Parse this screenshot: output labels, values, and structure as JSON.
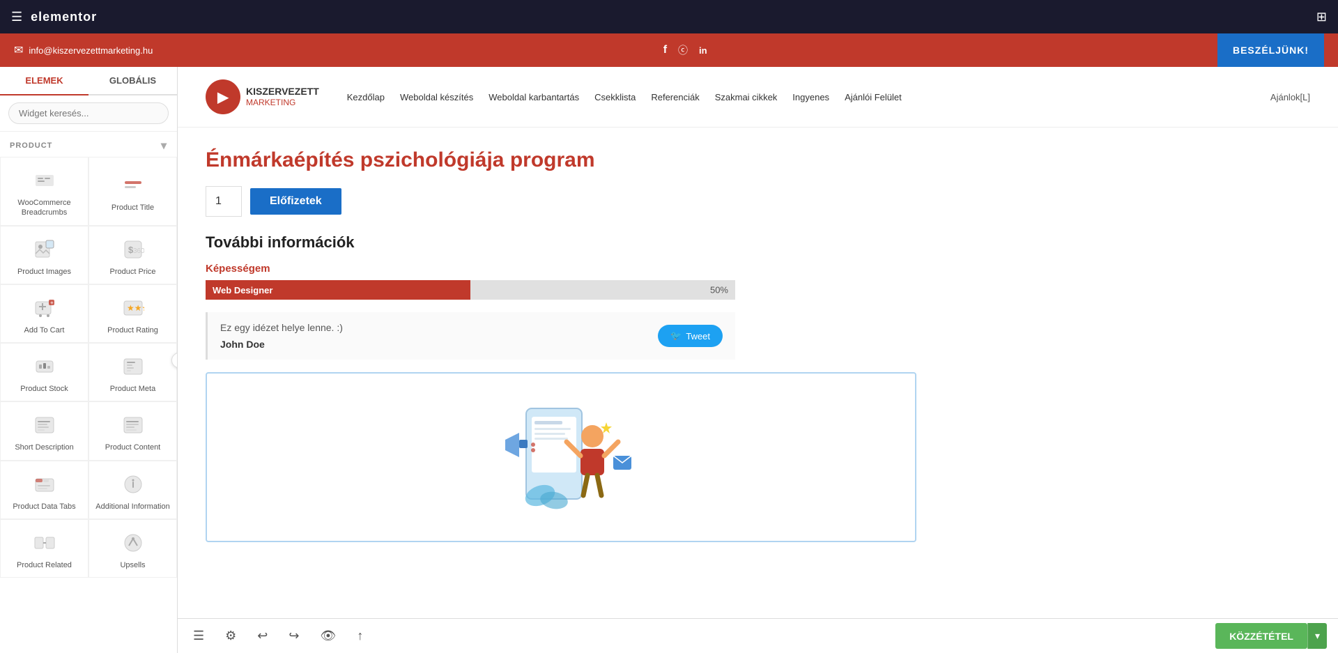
{
  "topbar": {
    "email": "info@kiszervezettmarketing.hu",
    "speak_btn": "BESZÉLJÜNK!",
    "email_icon": "✉",
    "facebook_icon": "f",
    "instagram_icon": "📷",
    "linkedin_icon": "in"
  },
  "elementor_header": {
    "logo": "elementor",
    "hamburger_icon": "☰",
    "grid_icon": "⊞"
  },
  "sidebar": {
    "tab_elemek": "ELEMEK",
    "tab_globalis": "GLOBÁLIS",
    "search_placeholder": "Widget keresés...",
    "section_label": "PRODUCT",
    "widgets": [
      {
        "id": "woocommerce-breadcrumbs",
        "label": "WooCommerce Breadcrumbs"
      },
      {
        "id": "product-title",
        "label": "Product Title"
      },
      {
        "id": "product-images",
        "label": "Product Images"
      },
      {
        "id": "product-price",
        "label": "Product Price"
      },
      {
        "id": "add-to-cart",
        "label": "Add To Cart"
      },
      {
        "id": "product-rating",
        "label": "Product Rating"
      },
      {
        "id": "product-stock",
        "label": "Product Stock"
      },
      {
        "id": "product-meta",
        "label": "Product Meta"
      },
      {
        "id": "short-description",
        "label": "Short Description"
      },
      {
        "id": "product-content",
        "label": "Product Content"
      },
      {
        "id": "product-data-tabs",
        "label": "Product Data Tabs"
      },
      {
        "id": "additional-information",
        "label": "Additional Information"
      },
      {
        "id": "product-related",
        "label": "Product Related"
      },
      {
        "id": "upsells",
        "label": "Upsells"
      }
    ]
  },
  "site_nav": {
    "logo_text_main": "KISZERVEZETT",
    "logo_text_sub": "MARKETING",
    "links": [
      "Kezdőlap",
      "Weboldal készítés",
      "Weboldal karbantartás",
      "Csekklista",
      "Referenciák",
      "Szakmai cikkek",
      "Ingyenes",
      "Ajánlói Felület"
    ],
    "ajanloi": "Ajánlok[L]"
  },
  "product": {
    "title": "Énmárkaépítés pszichológiája program",
    "qty_value": "1",
    "subscribe_btn": "Előfizetek",
    "further_info": "További információk",
    "kepessegem_label": "Képességem",
    "skill_name": "Web Designer",
    "skill_pct": "50%",
    "skill_pct_num": 50,
    "quote_text": "Ez egy idézet helye lenne. :)",
    "quote_author": "John Doe",
    "tweet_btn": "Tweet"
  },
  "bottom_toolbar": {
    "history_icon": "↩",
    "redo_icon": "↪",
    "settings_icon": "⚙",
    "update_icon": "↑",
    "eye_icon": "👁",
    "publish_btn": "KÖZZÉTÉTEL",
    "publish_more_icon": "▾"
  }
}
